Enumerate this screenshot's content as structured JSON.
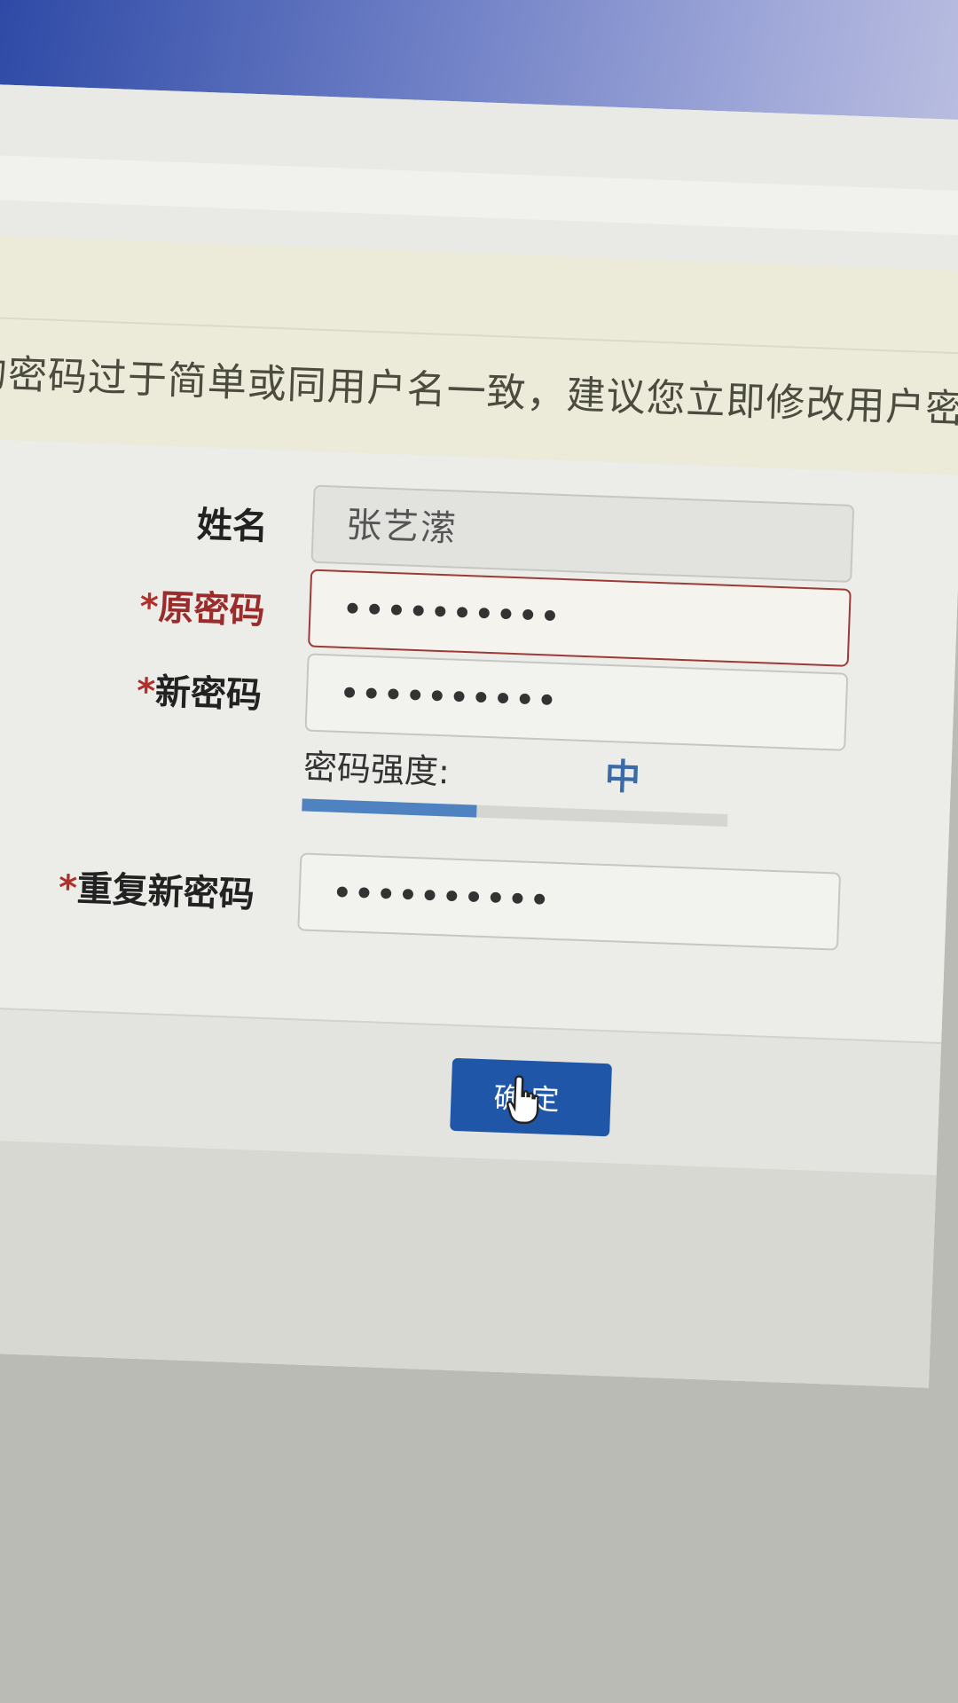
{
  "warning": {
    "title": "!",
    "message": "的密码过于简单或同用户名一致，建议您立即修改用户密码!"
  },
  "form": {
    "name_label": "姓名",
    "name_value": "张艺潆",
    "required_mark": "*",
    "old_password_label": "原密码",
    "old_password_value": "••••••••••",
    "new_password_label": "新密码",
    "new_password_value": "••••••••••",
    "strength_label": "密码强度:",
    "strength_value": "中",
    "strength_level_fraction": 0.41,
    "repeat_password_label": "重复新密码",
    "repeat_password_value": "••••••••••"
  },
  "footer": {
    "submit_label": "确定"
  },
  "icons": {
    "cursor": "hand-pointer-icon"
  },
  "colors": {
    "primary_button": "#1f56a8",
    "strength_bar": "#4f82c0",
    "required_asterisk": "#b0302a",
    "error_border": "#9e3a36"
  }
}
